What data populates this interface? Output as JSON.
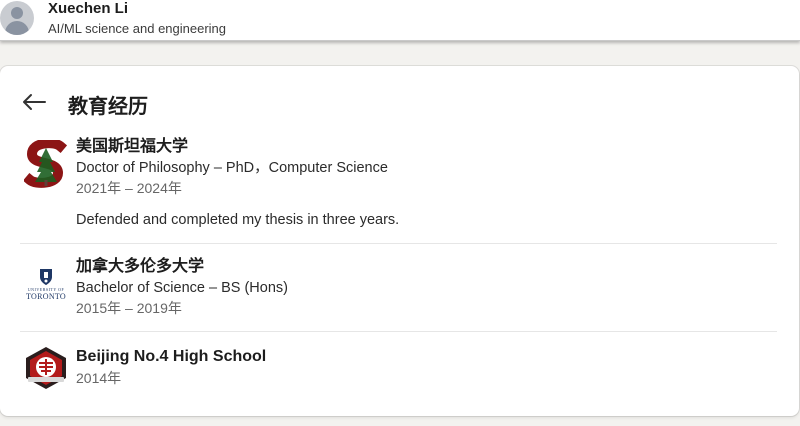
{
  "profile": {
    "name": "Xuechen Li",
    "headline": "AI/ML science and engineering"
  },
  "section": {
    "title": "教育经历",
    "back_icon": "arrow-left-icon"
  },
  "education": [
    {
      "school": "美国斯坦福大学",
      "degree": "Doctor of Philosophy – PhD，Computer Science",
      "dates": "2021年 – 2024年",
      "description": "Defended and completed my thesis in three years.",
      "logo_icon": "stanford-logo-icon",
      "logo_color": "#8c1515"
    },
    {
      "school": "加拿大多伦多大学",
      "degree": "Bachelor of Science – BS (Hons)",
      "dates": "2015年 – 2019年",
      "logo_text_top": "UNIVERSITY OF",
      "logo_text": "TORONTO",
      "logo_icon": "toronto-logo-icon",
      "logo_color": "#1e3765"
    },
    {
      "school": "Beijing No.4 High School",
      "dates": "2014年",
      "logo_icon": "beijing-no4-logo-icon",
      "logo_color": "#b31b1b"
    }
  ]
}
